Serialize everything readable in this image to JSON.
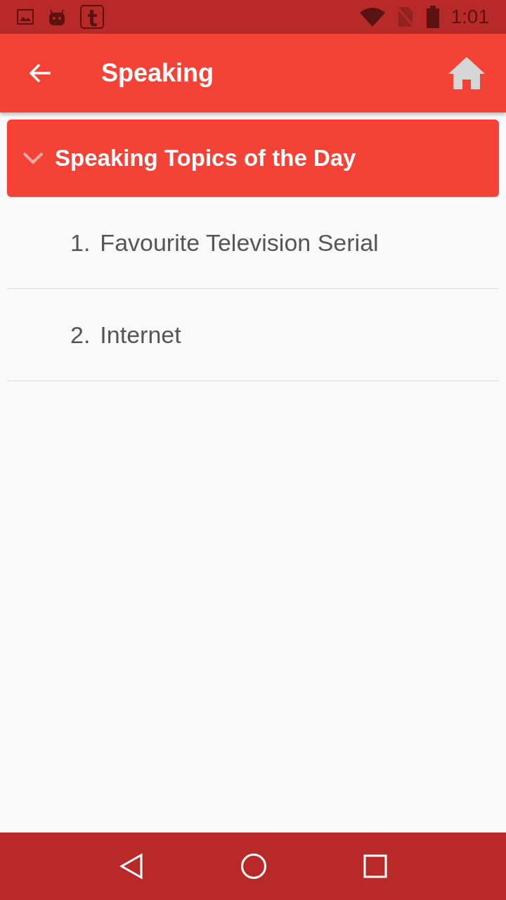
{
  "status_bar": {
    "time": "1:01"
  },
  "app_bar": {
    "title": "Speaking"
  },
  "section": {
    "title": "Speaking Topics of the Day",
    "expanded": true,
    "items": [
      {
        "number": "1.",
        "label": "Favourite Television Serial"
      },
      {
        "number": "2.",
        "label": "Internet"
      }
    ]
  }
}
